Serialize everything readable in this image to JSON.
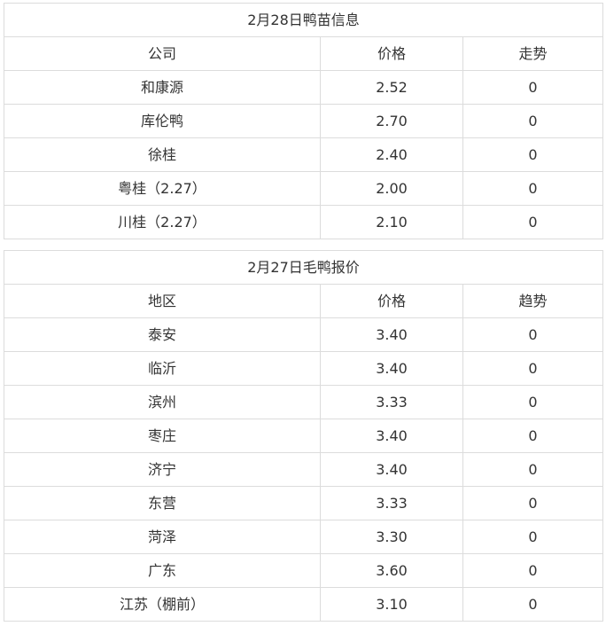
{
  "duckling": {
    "title": "2月28日鸭苗信息",
    "headers": [
      "公司",
      "价格",
      "走势"
    ],
    "rows": [
      [
        "和康源",
        "2.52",
        "0"
      ],
      [
        "库伦鸭",
        "2.70",
        "0"
      ],
      [
        "徐桂",
        "2.40",
        "0"
      ],
      [
        "粤桂（2.27）",
        "2.00",
        "0"
      ],
      [
        "川桂（2.27）",
        "2.10",
        "0"
      ]
    ]
  },
  "duck": {
    "title": "2月27日毛鸭报价",
    "headers": [
      "地区",
      "价格",
      "趋势"
    ],
    "rows": [
      [
        "泰安",
        "3.40",
        "0"
      ],
      [
        "临沂",
        "3.40",
        "0"
      ],
      [
        "滨州",
        "3.33",
        "0"
      ],
      [
        "枣庄",
        "3.40",
        "0"
      ],
      [
        "济宁",
        "3.40",
        "0"
      ],
      [
        "东营",
        "3.33",
        "0"
      ],
      [
        "菏泽",
        "3.30",
        "0"
      ],
      [
        "广东",
        "3.60",
        "0"
      ],
      [
        "江苏（棚前）",
        "3.10",
        "0"
      ]
    ]
  }
}
